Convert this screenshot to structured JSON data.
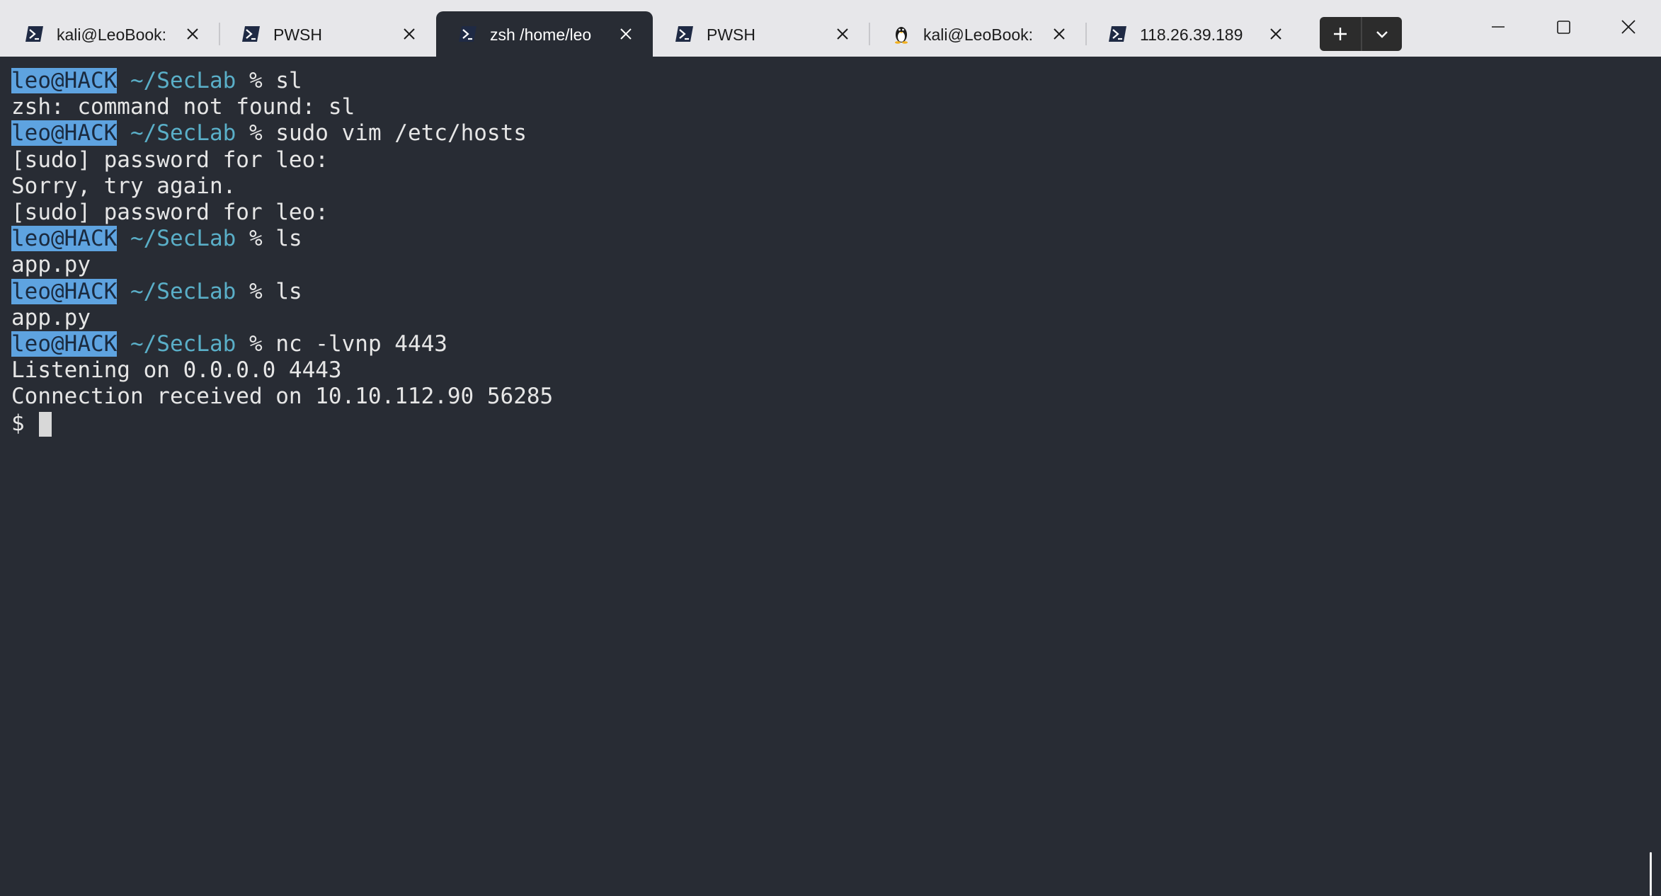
{
  "tabs": [
    {
      "label": "kali@LeoBook:",
      "icon": "powershell-icon",
      "active": false
    },
    {
      "label": "PWSH",
      "icon": "powershell-icon",
      "active": false
    },
    {
      "label": "zsh /home/leo",
      "icon": "powershell-icon",
      "active": true
    },
    {
      "label": "PWSH",
      "icon": "powershell-icon",
      "active": false
    },
    {
      "label": "kali@LeoBook:",
      "icon": "linux-penguin-icon",
      "active": false
    },
    {
      "label": "118.26.39.189",
      "icon": "powershell-icon",
      "active": false
    }
  ],
  "toolbar": {
    "new_tab_icon": "plus-icon",
    "dropdown_icon": "chevron-down-icon"
  },
  "window_controls": [
    "minimize-icon",
    "maximize-icon",
    "close-icon"
  ],
  "terminal": {
    "prompt": {
      "userhost": "leo@HACK",
      "path": "~/SecLab",
      "symbol": "%"
    },
    "lines": [
      {
        "type": "prompt",
        "command": "sl"
      },
      {
        "type": "output",
        "text": "zsh: command not found: sl"
      },
      {
        "type": "prompt",
        "command": "sudo vim /etc/hosts"
      },
      {
        "type": "output",
        "text": "[sudo] password for leo:"
      },
      {
        "type": "output",
        "text": "Sorry, try again."
      },
      {
        "type": "output",
        "text": "[sudo] password for leo:"
      },
      {
        "type": "prompt",
        "command": "ls"
      },
      {
        "type": "output",
        "text": "app.py"
      },
      {
        "type": "prompt",
        "command": "ls"
      },
      {
        "type": "output",
        "text": "app.py"
      },
      {
        "type": "prompt",
        "command": "nc -lvnp 4443"
      },
      {
        "type": "output",
        "text": "Listening on 0.0.0.0 4443"
      },
      {
        "type": "output",
        "text": "Connection received on 10.10.112.90 56285"
      },
      {
        "type": "shell",
        "text": "$ "
      }
    ]
  },
  "colors": {
    "terminal_bg": "#282c34",
    "titlebar_bg": "#e7e7ea",
    "userhost_highlight": "#5ea3e0",
    "path": "#5aafc8",
    "text": "#e6e6e6"
  }
}
